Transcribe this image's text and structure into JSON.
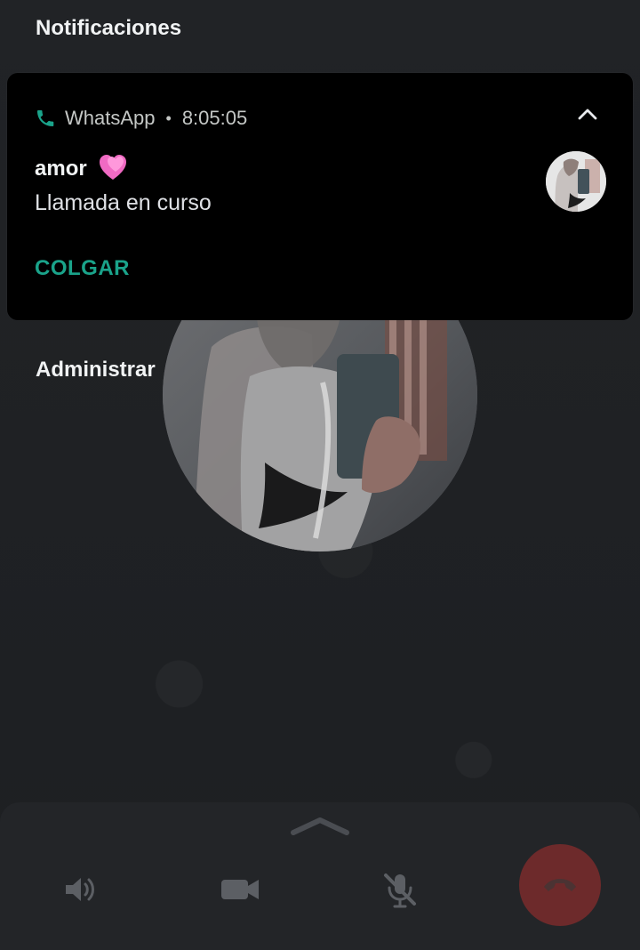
{
  "header": {
    "title": "Notificaciones"
  },
  "notification": {
    "app_name": "WhatsApp",
    "separator": "•",
    "time": "8:05:05",
    "contact_name": "amor",
    "status": "Llamada en curso",
    "action_label": "COLGAR"
  },
  "manage": {
    "label": "Administrar"
  },
  "icons": {
    "app": "phone-icon",
    "expand": "chevron-up-icon",
    "contact_emoji": "heart-emoji-icon",
    "speaker": "speaker-icon",
    "video": "video-camera-icon",
    "mic_off": "microphone-off-icon",
    "end_call": "end-call-icon",
    "panel_handle": "chevron-up-icon"
  },
  "colors": {
    "accent": "#1aa38a",
    "end_call": "#6d2a2b",
    "notification_bg": "#000000",
    "screen_bg": "#1f2124"
  }
}
